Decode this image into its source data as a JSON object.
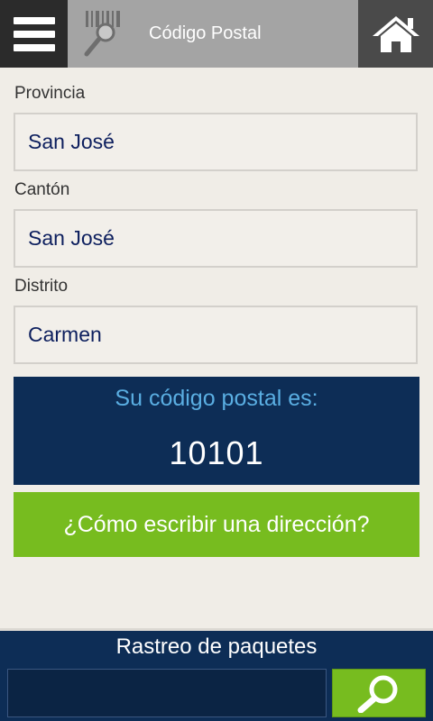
{
  "header": {
    "title": "Código Postal",
    "menu_icon": "hamburger-menu-icon",
    "barcode_icon": "barcode-search-icon",
    "home_icon": "home-icon"
  },
  "form": {
    "provincia": {
      "label": "Provincia",
      "value": "San José"
    },
    "canton": {
      "label": "Cantón",
      "value": "San José"
    },
    "distrito": {
      "label": "Distrito",
      "value": "Carmen"
    }
  },
  "result": {
    "label": "Su código postal es:",
    "code": "10101"
  },
  "howto_button": "¿Cómo escribir una dirección?",
  "footer": {
    "title": "Rastreo de paquetes",
    "input_value": "",
    "search_icon": "search-icon"
  },
  "colors": {
    "navy": "#0d2d56",
    "green": "#77bc1f",
    "light_blue": "#5aaee2",
    "background": "#f0ede7"
  }
}
